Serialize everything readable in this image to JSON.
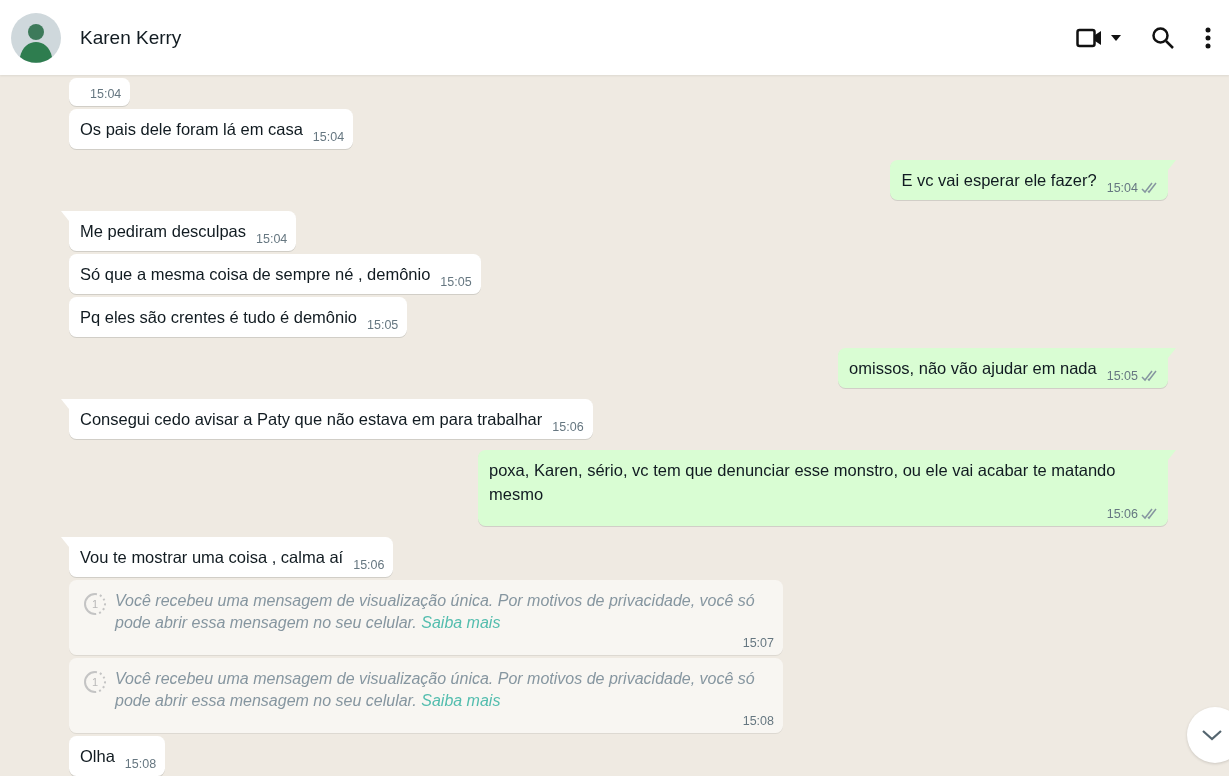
{
  "header": {
    "contact_name": "Karen Kerry"
  },
  "messages": [
    {
      "kind": "incoming",
      "tail": false,
      "time": "15:04"
    },
    {
      "kind": "incoming",
      "tail": false,
      "text": "Os pais dele foram lá em casa",
      "time": "15:04"
    },
    {
      "kind": "outgoing",
      "tail": true,
      "text": "E vc vai esperar ele fazer?",
      "time": "15:04",
      "read": false
    },
    {
      "kind": "incoming",
      "tail": true,
      "text": "Me pediram desculpas",
      "time": "15:04"
    },
    {
      "kind": "incoming",
      "tail": false,
      "text": "Só que a mesma coisa de sempre né , demônio",
      "time": "15:05"
    },
    {
      "kind": "incoming",
      "tail": false,
      "text": "Pq eles são crentes é tudo é demônio",
      "time": "15:05"
    },
    {
      "kind": "outgoing",
      "tail": true,
      "text": "omissos, não vão ajudar em nada",
      "time": "15:05",
      "read": false
    },
    {
      "kind": "incoming",
      "tail": true,
      "text": "Consegui cedo avisar a Paty que não estava em para trabalhar",
      "time": "15:06"
    },
    {
      "kind": "outgoing",
      "tail": true,
      "text": "poxa, Karen, sério, vc tem que denunciar esse monstro, ou ele vai acabar te matando mesmo",
      "time": "15:06",
      "read": false
    },
    {
      "kind": "incoming",
      "tail": true,
      "text": "Vou te mostrar uma coisa , calma aí",
      "time": "15:06"
    },
    {
      "kind": "view_once",
      "icon_text": "1",
      "text": "Você recebeu uma mensagem de visualização única. Por motivos de privacidade, você só pode abrir essa mensagem no seu celular.",
      "link": "Saiba mais",
      "time": "15:07"
    },
    {
      "kind": "view_once",
      "icon_text": "1",
      "text": "Você recebeu uma mensagem de visualização única. Por motivos de privacidade, você só pode abrir essa mensagem no seu celular.",
      "link": "Saiba mais",
      "time": "15:08"
    },
    {
      "kind": "incoming",
      "tail": false,
      "text": "Olha",
      "time": "15:08"
    }
  ]
}
